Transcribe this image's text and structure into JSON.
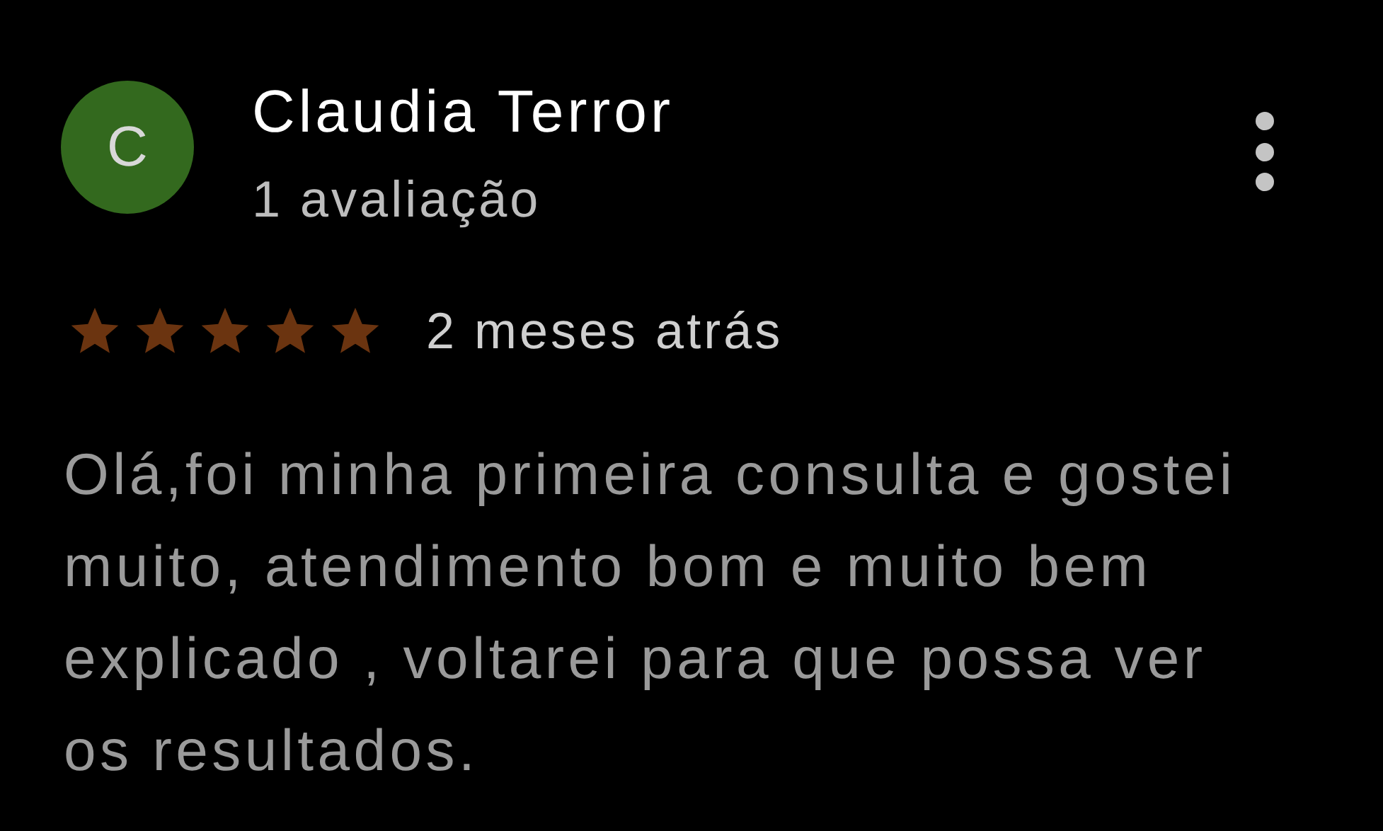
{
  "review": {
    "avatar_letter": "C",
    "author": "Claudia Terror",
    "author_reviews": "1 avaliação",
    "stars": 5,
    "time": "2 meses atrás",
    "text": "Olá,foi minha primeira consulta e gostei muito, atendimento bom e muito bem explicado , voltarei para que possa ver os resultados."
  }
}
